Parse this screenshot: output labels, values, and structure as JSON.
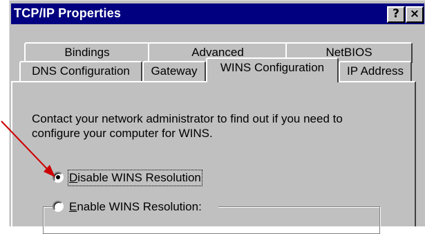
{
  "window": {
    "title": "TCP/IP Properties",
    "help_button": "?",
    "close_button": "×"
  },
  "tabs": {
    "back_row": [
      "Bindings",
      "Advanced",
      "NetBIOS"
    ],
    "front_row": [
      "DNS Configuration",
      "Gateway",
      "WINS Configuration",
      "IP Address"
    ],
    "active": "WINS Configuration"
  },
  "panel": {
    "description_line1": "Contact your network administrator to find out if you need to",
    "description_line2": "configure your computer for WINS.",
    "options": [
      {
        "label_mnemonic": "D",
        "label_rest": "isable WINS Resolution",
        "selected": true
      },
      {
        "label_mnemonic": "E",
        "label_rest": "nable WINS Resolution:",
        "selected": false
      }
    ]
  },
  "annotation": {
    "arrow_color": "#cc0000"
  }
}
